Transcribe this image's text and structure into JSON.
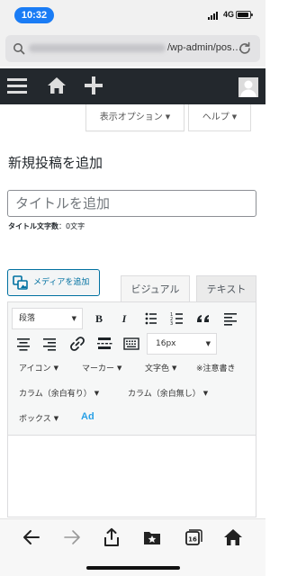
{
  "status_bar": {
    "time": "10:32",
    "network": "4G"
  },
  "url_bar": {
    "visible_url_suffix": "/wp-admin/pos…"
  },
  "admin_bar": {
    "menu_icon": "hamburger-icon",
    "home_icon": "home-icon",
    "add_icon": "plus-icon",
    "avatar_icon": "avatar-icon"
  },
  "screen_options": {
    "label": "表示オプション",
    "help": "ヘルプ"
  },
  "page": {
    "title": "新規投稿を追加"
  },
  "title_field": {
    "placeholder": "タイトルを追加",
    "count_label": "タイトル文字数",
    "count_value": "：0文字"
  },
  "media": {
    "add_media_label": "メディアを追加"
  },
  "editor_tabs": {
    "visual": "ビジュアル",
    "text": "テキスト"
  },
  "toolbar": {
    "format_select": "段落",
    "font_size_select": "16px",
    "row3": [
      "アイコン",
      "マーカー",
      "文字色",
      "※注意書き"
    ],
    "row4": [
      "カラム（余白有り）",
      "カラム（余白無し）"
    ],
    "row5": [
      "ボックス"
    ],
    "ad_label": "Ad"
  },
  "colors": {
    "accent": "#0071a1",
    "admin_bar": "#23282d",
    "time_pill": "#1a7cf5",
    "ad_blue": "#28a0e6"
  }
}
